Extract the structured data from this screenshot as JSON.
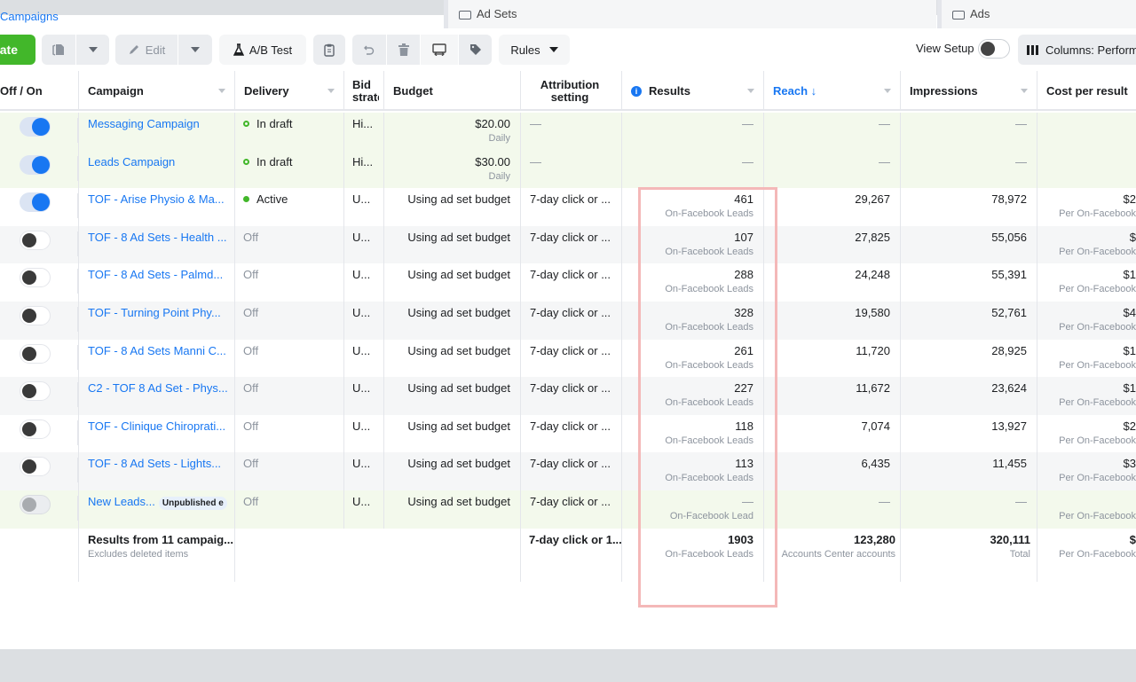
{
  "nav": {
    "breadcrumb_partial": "Campaigns",
    "tabs": [
      {
        "label": "Ad Sets",
        "icon": "ad-sets-icon"
      },
      {
        "label": "Ads",
        "icon": "ads-icon"
      }
    ]
  },
  "toolbar": {
    "create_label": "Create",
    "duplicate_icon": "duplicate-icon",
    "edit_label": "Edit",
    "ab_test_label": "A/B Test",
    "rules_label": "Rules",
    "view_setup_label": "View Setup",
    "columns_label": "Columns: Performance"
  },
  "table": {
    "headers": {
      "off_on": "Off / On",
      "campaign": "Campaign",
      "delivery": "Delivery",
      "bid_strategy": "Bid strategy",
      "budget": "Budget",
      "attribution": "Attribution setting",
      "results": "Results",
      "reach": "Reach ↓",
      "impressions": "Impressions",
      "cost_per_result": "Cost per result"
    },
    "rows": [
      {
        "toggle": "on",
        "campaign": "Messaging Campaign",
        "badge": "",
        "delivery": "In draft",
        "delivery_status": "draft",
        "bid": "Hi...",
        "budget": "$20.00",
        "budget_sub": "Daily",
        "attribution": "—",
        "results": "—",
        "results_sub": "",
        "reach": "—",
        "impressions": "—",
        "cpr": "",
        "cpr_sub": "",
        "style": "draft"
      },
      {
        "toggle": "on",
        "campaign": "Leads Campaign",
        "badge": "",
        "delivery": "In draft",
        "delivery_status": "draft",
        "bid": "Hi...",
        "budget": "$30.00",
        "budget_sub": "Daily",
        "attribution": "—",
        "results": "—",
        "results_sub": "",
        "reach": "—",
        "impressions": "—",
        "cpr": "",
        "cpr_sub": "",
        "style": "draft"
      },
      {
        "toggle": "on",
        "campaign": "TOF - Arise Physio & Ma...",
        "badge": "",
        "delivery": "Active",
        "delivery_status": "active",
        "bid": "U...",
        "budget": "Using ad set budget",
        "budget_sub": "",
        "attribution": "7-day click or ...",
        "results": "461",
        "results_sub": "On-Facebook Leads",
        "reach": "29,267",
        "impressions": "78,972",
        "cpr": "$2",
        "cpr_sub": "Per On-Facebook",
        "style": "white"
      },
      {
        "toggle": "off",
        "campaign": "TOF - 8 Ad Sets - Health ...",
        "badge": "",
        "delivery": "Off",
        "delivery_status": "off",
        "bid": "U...",
        "budget": "Using ad set budget",
        "budget_sub": "",
        "attribution": "7-day click or ...",
        "results": "107",
        "results_sub": "On-Facebook Leads",
        "reach": "27,825",
        "impressions": "55,056",
        "cpr": "$",
        "cpr_sub": "Per On-Facebook",
        "style": "alt"
      },
      {
        "toggle": "off",
        "campaign": "TOF - 8 Ad Sets - Palmd...",
        "badge": "",
        "delivery": "Off",
        "delivery_status": "off",
        "bid": "U...",
        "budget": "Using ad set budget",
        "budget_sub": "",
        "attribution": "7-day click or ...",
        "results": "288",
        "results_sub": "On-Facebook Leads",
        "reach": "24,248",
        "impressions": "55,391",
        "cpr": "$1",
        "cpr_sub": "Per On-Facebook",
        "style": "white"
      },
      {
        "toggle": "off",
        "campaign": "TOF - Turning Point Phy...",
        "badge": "",
        "delivery": "Off",
        "delivery_status": "off",
        "bid": "U...",
        "budget": "Using ad set budget",
        "budget_sub": "",
        "attribution": "7-day click or ...",
        "results": "328",
        "results_sub": "On-Facebook Leads",
        "reach": "19,580",
        "impressions": "52,761",
        "cpr": "$4",
        "cpr_sub": "Per On-Facebook",
        "style": "alt"
      },
      {
        "toggle": "off",
        "campaign": "TOF - 8 Ad Sets Manni C...",
        "badge": "",
        "delivery": "Off",
        "delivery_status": "off",
        "bid": "U...",
        "budget": "Using ad set budget",
        "budget_sub": "",
        "attribution": "7-day click or ...",
        "results": "261",
        "results_sub": "On-Facebook Leads",
        "reach": "11,720",
        "impressions": "28,925",
        "cpr": "$1",
        "cpr_sub": "Per On-Facebook",
        "style": "white"
      },
      {
        "toggle": "off",
        "campaign": "C2 - TOF 8 Ad Set - Phys...",
        "badge": "",
        "delivery": "Off",
        "delivery_status": "off",
        "bid": "U...",
        "budget": "Using ad set budget",
        "budget_sub": "",
        "attribution": "7-day click or ...",
        "results": "227",
        "results_sub": "On-Facebook Leads",
        "reach": "11,672",
        "impressions": "23,624",
        "cpr": "$1",
        "cpr_sub": "Per On-Facebook",
        "style": "alt"
      },
      {
        "toggle": "off",
        "campaign": "TOF - Clinique Chiroprati...",
        "badge": "",
        "delivery": "Off",
        "delivery_status": "off",
        "bid": "U...",
        "budget": "Using ad set budget",
        "budget_sub": "",
        "attribution": "7-day click or ...",
        "results": "118",
        "results_sub": "On-Facebook Leads",
        "reach": "7,074",
        "impressions": "13,927",
        "cpr": "$2",
        "cpr_sub": "Per On-Facebook",
        "style": "white"
      },
      {
        "toggle": "off",
        "campaign": "TOF - 8 Ad Sets - Lights...",
        "badge": "",
        "delivery": "Off",
        "delivery_status": "off",
        "bid": "U...",
        "budget": "Using ad set budget",
        "budget_sub": "",
        "attribution": "7-day click or ...",
        "results": "113",
        "results_sub": "On-Facebook Leads",
        "reach": "6,435",
        "impressions": "11,455",
        "cpr": "$3",
        "cpr_sub": "Per On-Facebook",
        "style": "alt"
      },
      {
        "toggle": "disabled",
        "campaign": "New Leads...",
        "badge": "Unpublished e",
        "delivery": "Off",
        "delivery_status": "off",
        "bid": "U...",
        "budget": "Using ad set budget",
        "budget_sub": "",
        "attribution": "7-day click or ...",
        "results": "—",
        "results_sub": "On-Facebook Lead",
        "reach": "—",
        "impressions": "—",
        "cpr": "",
        "cpr_sub": "Per On-Facebook",
        "style": "draft"
      }
    ],
    "total": {
      "campaign": "Results from 11 campaig...",
      "campaign_sub": "Excludes deleted items",
      "attribution": "7-day click or 1...",
      "results": "1903",
      "results_sub": "On-Facebook Leads",
      "reach": "123,280",
      "reach_sub": "Accounts Center accounts",
      "impressions": "320,111",
      "impressions_sub": "Total",
      "cpr": "$",
      "cpr_sub": "Per On-Facebook"
    }
  },
  "colors": {
    "accent": "#1877f2",
    "create_green": "#42b72a",
    "draft_row": "#f3f9ec",
    "highlight_box": "#f4b8b8"
  }
}
